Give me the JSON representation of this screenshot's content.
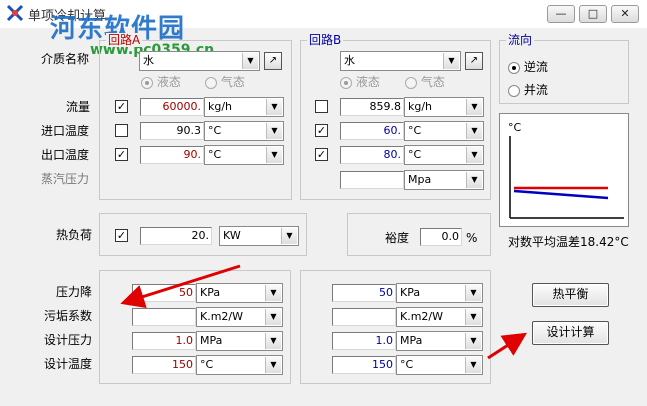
{
  "window": {
    "title": "单项冷却计算",
    "watermark": "河东软件园",
    "watermark_url": "www.pc0359.cn",
    "min_icon": "minimize-icon",
    "max_icon": "maximize-icon",
    "close_icon": "close-icon",
    "accent": "#1b6dc7"
  },
  "circuit_a": {
    "title": "回路A",
    "medium_label": "介质名称",
    "medium_value": "水",
    "radio_liquid": "液态",
    "radio_gas": "气态",
    "flow_label": "流量",
    "flow_value": "60000.",
    "flow_unit": "kg/h",
    "inlet_label": "进口温度",
    "inlet_value": "90.3",
    "inlet_unit": "°C",
    "outlet_label": "出口温度",
    "outlet_value": "90.",
    "outlet_unit": "°C",
    "steam_label": "蒸汽压力"
  },
  "circuit_b": {
    "title": "回路B",
    "medium_value": "水",
    "radio_liquid": "液态",
    "radio_gas": "气态",
    "flow_value": "859.8",
    "flow_unit": "kg/h",
    "inlet_value": "60.",
    "inlet_unit": "°C",
    "outlet_value": "80.",
    "outlet_unit": "°C",
    "steam_unit": "Mpa"
  },
  "flow_dir": {
    "title": "流向",
    "counter": "逆流",
    "parallel": "并流"
  },
  "plot": {
    "unit": "°C",
    "caption": "对数平均温差18.42°C"
  },
  "heat": {
    "label": "热负荷",
    "value": "20.",
    "unit": "KW",
    "margin_label": "裕度",
    "margin_value": "0.0",
    "margin_unit": "%"
  },
  "bottom_labels": {
    "pressure_drop": "压力降",
    "fouling": "污垢系数",
    "design_pressure": "设计压力",
    "design_temp": "设计温度"
  },
  "bottom_a": {
    "pd_value": "50",
    "pd_unit": "KPa",
    "fouling_unit": "K.m2/W",
    "dp_value": "1.0",
    "dp_unit": "MPa",
    "dt_value": "150",
    "dt_unit": "°C"
  },
  "bottom_b": {
    "pd_value": "50",
    "pd_unit": "KPa",
    "fouling_unit": "K.m2/W",
    "dp_value": "1.0",
    "dp_unit": "MPa",
    "dt_value": "150",
    "dt_unit": "°C"
  },
  "buttons": {
    "heat_balance": "热平衡",
    "design_calc": "设计计算"
  },
  "colors": {
    "hot_line": "#e00000",
    "cold_line": "#0000c0",
    "annotation_arrow": "#e00000"
  }
}
